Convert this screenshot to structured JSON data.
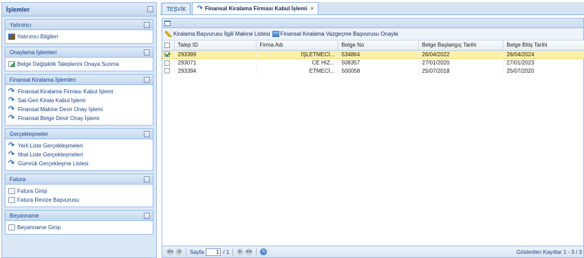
{
  "nav": {
    "title": "İşlemler",
    "sections": [
      {
        "title": "Yatırımcı",
        "items": [
          {
            "icon": "investor-icon",
            "label": "Yatırımcı Bilgileri"
          }
        ]
      },
      {
        "title": "Onaylama İşlemleri",
        "items": [
          {
            "icon": "approve-doc-icon",
            "label": "Belge Değişiklik Taleplerini Onaya Sunma"
          }
        ]
      },
      {
        "title": "Finansal Kiralama İşlemleri",
        "items": [
          {
            "icon": "process-arrow-icon",
            "label": "Finansal Kiralama Firması Kabul İşlemi"
          },
          {
            "icon": "process-arrow-icon",
            "label": "Sat-Geri Kirala Kabul İşlemi"
          },
          {
            "icon": "process-arrow-icon",
            "label": "Finansal Makine Devir Onay İşlemi"
          },
          {
            "icon": "process-arrow-icon",
            "label": "Finansal Belge Devir Onay İşlemi"
          }
        ]
      },
      {
        "title": "Gerçekleşmeler",
        "items": [
          {
            "icon": "process-arrow-icon",
            "label": "Yerli Liste Gerçekleşmeleri"
          },
          {
            "icon": "process-arrow-icon",
            "label": "İthal Liste Gerçekleşmeleri"
          },
          {
            "icon": "process-arrow-icon",
            "label": "Gümrük Gerçekleşme Listesi"
          }
        ]
      },
      {
        "title": "Fatura",
        "items": [
          {
            "icon": "document-icon",
            "label": "Fatura Girişi"
          },
          {
            "icon": "document-icon",
            "label": "Fatura Revize Başvurusu"
          }
        ]
      },
      {
        "title": "Beyanname",
        "items": [
          {
            "icon": "document-icon",
            "label": "Beyanname Girişi"
          }
        ]
      }
    ]
  },
  "tabs": [
    {
      "label": "TEŞVİK",
      "active": false
    },
    {
      "label": "Finansal Kiralama Firması Kabul İşlemi",
      "active": true,
      "close": "×"
    }
  ],
  "toolbar": {
    "machine_list_label": "Kiralama Başvurusu İlgili Makine Listesi",
    "withdraw_label": "Finansal Kiralama Vazgeçme Başvurusu Onayla"
  },
  "grid": {
    "columns": [
      "Talep ID",
      "Firma Adı",
      "Belge No",
      "Belge Başlangıç Tarihi",
      "Belge Bitiş Tarihi"
    ],
    "rows": [
      {
        "selected": true,
        "talep_id": "293399",
        "firma_adi": "İŞLETMECİ...",
        "belge_no": "534864",
        "baslangic": "26/04/2022",
        "bitis": "26/04/2024"
      },
      {
        "selected": false,
        "talep_id": "293071",
        "firma_adi": "CE HİZ...",
        "belge_no": "508357",
        "baslangic": "27/01/2020",
        "bitis": "27/01/2023"
      },
      {
        "selected": false,
        "talep_id": "293394",
        "firma_adi": "ETMECİ...",
        "belge_no": "500058",
        "baslangic": "25/07/2018",
        "bitis": "25/07/2020"
      }
    ]
  },
  "pager": {
    "page_label": "Sayfa",
    "page_value": "1",
    "page_total": "/ 1",
    "summary": "Gösterilen Kayıtlar 1 - 3 / 3"
  },
  "colors": {
    "selected_row": "#fbf0a8",
    "header_text": "#15428b",
    "panel_border": "#99bbe8"
  }
}
